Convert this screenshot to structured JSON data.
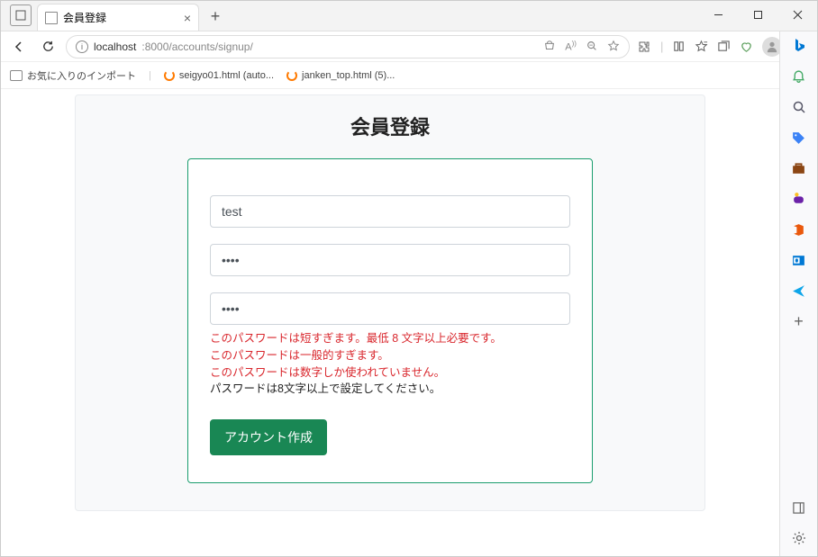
{
  "window": {
    "tab_title": "会員登録",
    "url_host": "localhost",
    "url_port_path": ":8000/accounts/signup/"
  },
  "bookmarks": {
    "import": "お気に入りのインポート",
    "items": [
      "seigyo01.html (auto...",
      "janken_top.html (5)..."
    ]
  },
  "sidebar_icons": [
    "bing",
    "bell",
    "search",
    "tag",
    "briefcase",
    "people",
    "office",
    "outlook",
    "send",
    "plus"
  ],
  "page": {
    "title": "会員登録",
    "username_value": "test",
    "password1_value": "••••",
    "password2_value": "••••",
    "errors": [
      "このパスワードは短すぎます。最低 8 文字以上必要です。",
      "このパスワードは一般的すぎます。",
      "このパスワードは数字しか使われていません。"
    ],
    "help": "パスワードは8文字以上で設定してください。",
    "submit_label": "アカウント作成"
  }
}
